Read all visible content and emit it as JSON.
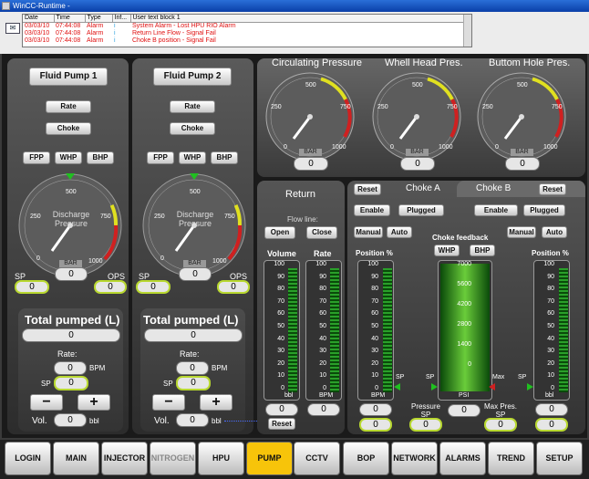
{
  "window": {
    "title": "WinCC-Runtime -"
  },
  "alarms": {
    "headers": [
      "Date",
      "Time",
      "Type",
      "Inf...",
      "User text block 1"
    ],
    "rows": [
      {
        "date": "03/03/10",
        "time": "07:44:08",
        "type": "Alarm",
        "inf": "i",
        "text": "System Alarm - Lost HPU RIO Alarm"
      },
      {
        "date": "03/03/10",
        "time": "07:44:08",
        "type": "Alarm",
        "inf": "i",
        "text": "Return Line Flow - Signal Fail"
      },
      {
        "date": "03/03/10",
        "time": "07:44:08",
        "type": "Alarm",
        "inf": "i",
        "text": "Choke B position - Signal Fail"
      }
    ]
  },
  "pumps": [
    {
      "title": "Fluid Pump 1",
      "rate": "Rate",
      "choke": "Choke",
      "fpp": "FPP",
      "whp": "WHP",
      "bhp": "BHP",
      "gauge": {
        "title": "Discharge Pressure",
        "unit": "BAR",
        "value": "0",
        "ticks": [
          "0",
          "250",
          "500",
          "750",
          "1000"
        ]
      },
      "sp_label": "SP",
      "sp_value": "0",
      "ops_label": "OPS",
      "ops_value": "0",
      "total_title": "Total pumped (L)",
      "total_value": "0",
      "rate_label": "Rate:",
      "rate_value": "0",
      "rate_unit": "BPM",
      "rate_sp_label": "SP",
      "rate_sp_value": "0",
      "minus": "−",
      "plus": "+",
      "vol_label": "Vol.",
      "vol_value": "0",
      "vol_unit": "bbl"
    },
    {
      "title": "Fluid Pump 2",
      "rate": "Rate",
      "choke": "Choke",
      "fpp": "FPP",
      "whp": "WHP",
      "bhp": "BHP",
      "gauge": {
        "title": "Discharge Pressure",
        "unit": "BAR",
        "value": "0",
        "ticks": [
          "0",
          "250",
          "500",
          "750",
          "1000"
        ]
      },
      "sp_label": "SP",
      "sp_value": "0",
      "ops_label": "OPS",
      "ops_value": "0",
      "total_title": "Total pumped (L)",
      "total_value": "0",
      "rate_label": "Rate:",
      "rate_value": "0",
      "rate_unit": "BPM",
      "rate_sp_label": "SP",
      "rate_sp_value": "0",
      "minus": "−",
      "plus": "+",
      "vol_label": "Vol.",
      "vol_value": "0",
      "vol_unit": "bbl"
    }
  ],
  "pressure_gauges": [
    {
      "title": "Circulating Pressure",
      "unit": "BAR",
      "value": "0",
      "ticks": [
        "0",
        "250",
        "500",
        "750",
        "1000"
      ]
    },
    {
      "title": "Whell Head Pres.",
      "unit": "BAR",
      "value": "0",
      "ticks": [
        "0",
        "250",
        "500",
        "750",
        "1000"
      ]
    },
    {
      "title": "Buttom Hole Pres.",
      "unit": "BAR",
      "value": "0",
      "ticks": [
        "0",
        "250",
        "500",
        "750",
        "1000"
      ]
    }
  ],
  "return": {
    "title": "Return",
    "flow_label": "Flow line:",
    "open": "Open",
    "close": "Close",
    "volume_label": "Volume",
    "rate_label": "Rate",
    "volume_ticks": [
      "100",
      "90",
      "80",
      "70",
      "60",
      "50",
      "40",
      "30",
      "20",
      "10",
      "0"
    ],
    "volume_unit": "bbl",
    "rate_unit": "BPM",
    "volume_value": "0",
    "rate_value": "0",
    "reset": "Reset"
  },
  "choke": {
    "reset_a": "Reset",
    "tab_a": "Choke A",
    "tab_b": "Choke B",
    "reset_b": "Reset",
    "enable_a": "Enable",
    "plugged_a": "Plugged",
    "enable_b": "Enable",
    "plugged_b": "Plugged",
    "manual_a": "Manual",
    "auto_a": "Auto",
    "manual_b": "Manual",
    "auto_b": "Auto",
    "position_label": "Position %",
    "feedback_label": "Choke feedback",
    "whp": "WHP",
    "bhp": "BHP",
    "pos_ticks": [
      "100",
      "90",
      "80",
      "70",
      "60",
      "50",
      "40",
      "30",
      "20",
      "10",
      "0"
    ],
    "psi_ticks": [
      "7000",
      "5600",
      "4200",
      "2800",
      "1400",
      "0"
    ],
    "sp": "SP",
    "max": "Max",
    "bbl": "BPM",
    "psi": "PSI",
    "bbl_unit": "bbl",
    "pos_a_value": "0",
    "pos_a_sp": "0",
    "pos_b_value": "0",
    "pos_b_sp": "0",
    "pressure_sp_label": "Pressure SP",
    "pressure_sp_value": "0",
    "feedback_value": "0",
    "max_pres_label": "Max Pres. SP",
    "max_pres_value": "0"
  },
  "nav": [
    "LOGIN",
    "MAIN",
    "INJECTOR",
    "NITROGEN",
    "HPU",
    "PUMP",
    "CCTV",
    "BOP",
    "NETWORK",
    "ALARMS",
    "TREND",
    "SETUP"
  ],
  "colors": {
    "active_nav": "#f7c40a",
    "disabled_nav": "#888888",
    "alarm_text": "#e01010",
    "bar_green": "#2aa02a",
    "highlight_border": "#b8d830"
  }
}
